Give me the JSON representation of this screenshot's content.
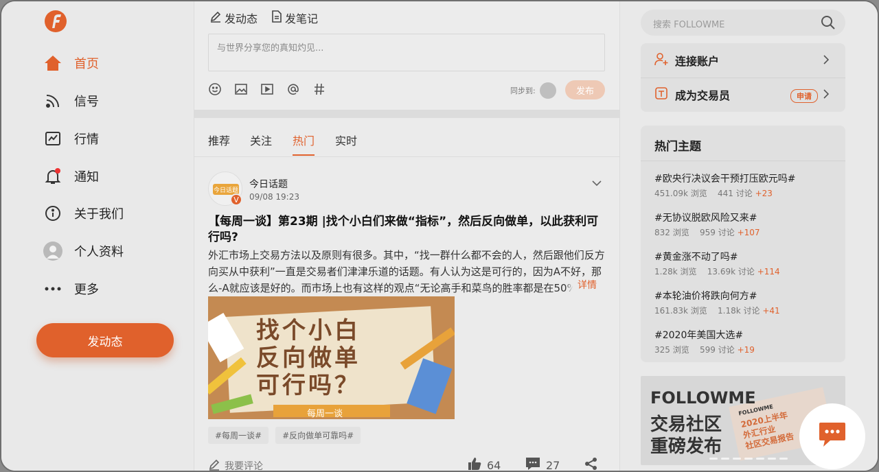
{
  "colors": {
    "accent": "#e0612c",
    "sidebar_bg": "#e9e9e9",
    "card_bg": "#e0e0e0"
  },
  "nav": {
    "items": [
      {
        "label": "首页",
        "icon": "home-icon",
        "active": true
      },
      {
        "label": "信号",
        "icon": "rss-icon"
      },
      {
        "label": "行情",
        "icon": "chart-icon"
      },
      {
        "label": "通知",
        "icon": "bell-icon",
        "badge_dot": true
      },
      {
        "label": "关于我们",
        "icon": "info-icon"
      },
      {
        "label": "个人资料",
        "icon": "avatar"
      },
      {
        "label": "更多",
        "icon": "more-icon"
      }
    ],
    "post_button": "发动态"
  },
  "composer": {
    "tab_post": "发动态",
    "tab_note": "发笔记",
    "placeholder": "与世界分享您的真知灼见...",
    "tools": [
      "emoji-icon",
      "image-icon",
      "video-icon",
      "mention-icon",
      "hashtag-icon"
    ],
    "sync_label": "同步到:",
    "publish": "发布"
  },
  "feed": {
    "tabs": [
      "推荐",
      "关注",
      "热门",
      "实时"
    ],
    "active_tab": "热门"
  },
  "post": {
    "avatar_tag": "今日话题",
    "verified": "V",
    "author": "今日话题",
    "time": "09/08 19:23",
    "title": "【每周一谈】第23期 |找个小白们来做“指标”，然后反向做单，以此获利可行吗?",
    "body": "外汇市场上交易方法以及原则有很多。其中，“找一群什么都不会的人，然后跟他们反方向买从中获利”一直是交易者们津津乐道的话题。有人认为这是可行的，因为A不好，那么-A就应该是好的。而市场上也有这样的观点“无论高手和菜鸟的胜率都是在50%",
    "more": "详情",
    "image_text": [
      "找个小白",
      "反向做单",
      "可行吗？"
    ],
    "image_caption": "每周一谈",
    "tags": [
      "#每周一谈#",
      "#反向做单可靠吗#"
    ],
    "comment": "我要评论",
    "likes": "64",
    "comments": "27"
  },
  "right": {
    "search_placeholder": "搜索 FOLLOWME",
    "connect_account": "连接账户",
    "become_trader": "成为交易员",
    "apply": "申请",
    "hot_title": "热门主题",
    "topics": [
      {
        "title": "#欧央行决议会干预打压欧元吗#",
        "views": "451.09k 浏览",
        "discuss": "441 讨论",
        "inc": "+23"
      },
      {
        "title": "#无协议脱欧风险又来#",
        "views": "832 浏览",
        "discuss": "959 讨论",
        "inc": "+107"
      },
      {
        "title": "#黄金涨不动了吗#",
        "views": "1.28k 浏览",
        "discuss": "13.69k 讨论",
        "inc": "+114"
      },
      {
        "title": "#本轮油价将跌向何方#",
        "views": "161.83k 浏览",
        "discuss": "1.18k 讨论",
        "inc": "+41"
      },
      {
        "title": "#2020年美国大选#",
        "views": "325 浏览",
        "discuss": "599 讨论",
        "inc": "+19"
      }
    ],
    "banner": {
      "line1": "FOLLOWME",
      "line2": "交易社区",
      "line3": "重磅发布",
      "paper_brand": "FOLLOWME",
      "paper_l1": "2020上半年",
      "paper_l2": "外汇行业",
      "paper_l3": "社区交易报告"
    }
  }
}
